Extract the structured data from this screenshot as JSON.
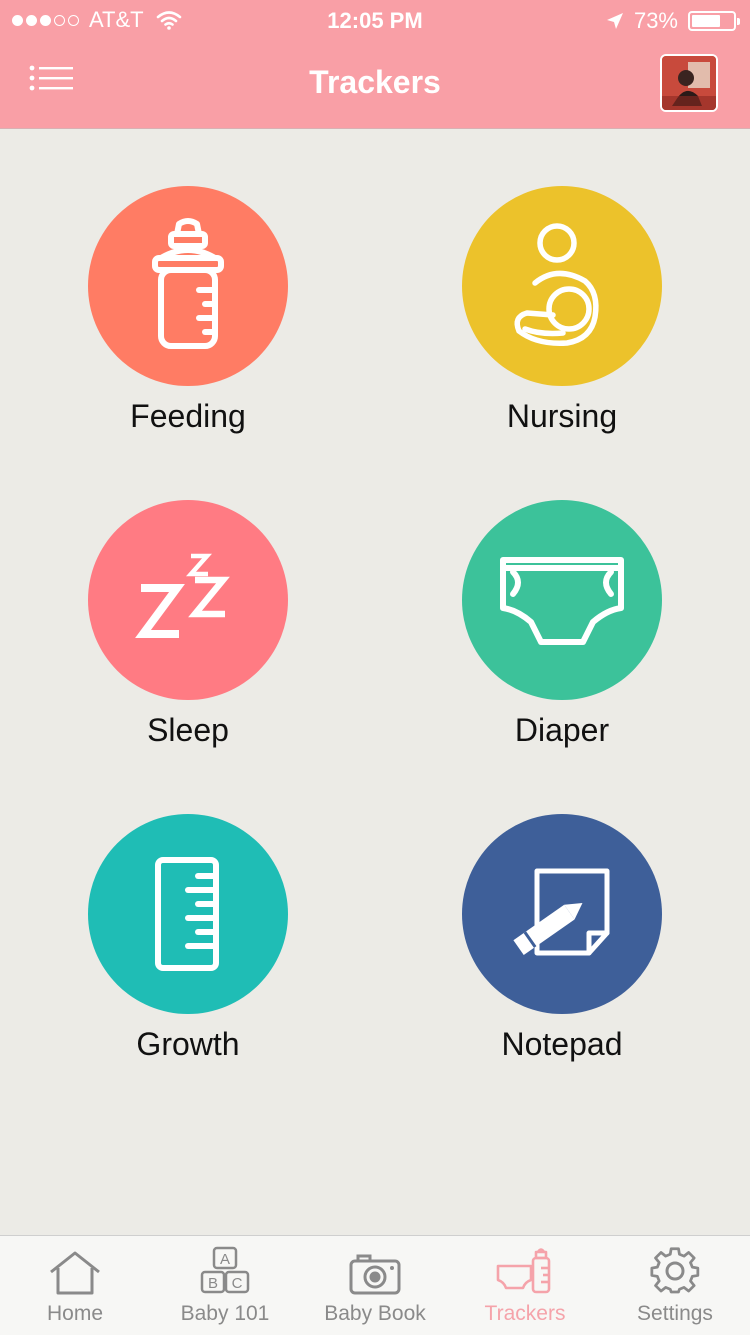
{
  "status_bar": {
    "carrier": "AT&T",
    "time": "12:05 PM",
    "battery": "73%",
    "battery_level": 0.73,
    "signal_bars_filled": 3,
    "signal_bars_total": 5
  },
  "nav": {
    "title": "Trackers",
    "menu_icon": "list-icon",
    "avatar": "profile-photo"
  },
  "trackers": [
    {
      "label": "Feeding",
      "color": "#ff7c64",
      "icon": "baby-bottle-icon"
    },
    {
      "label": "Nursing",
      "color": "#ecc22b",
      "icon": "nursing-mother-icon"
    },
    {
      "label": "Sleep",
      "color": "#ff7b83",
      "icon": "zzz-icon"
    },
    {
      "label": "Diaper",
      "color": "#3cc29a",
      "icon": "diaper-icon"
    },
    {
      "label": "Growth",
      "color": "#1fbdb5",
      "icon": "ruler-icon"
    },
    {
      "label": "Notepad",
      "color": "#3e5f99",
      "icon": "notepad-pencil-icon"
    }
  ],
  "tab_bar": {
    "tabs": [
      {
        "label": "Home",
        "icon": "home-icon"
      },
      {
        "label": "Baby 101",
        "icon": "abc-blocks-icon"
      },
      {
        "label": "Baby Book",
        "icon": "camera-icon"
      },
      {
        "label": "Trackers",
        "icon": "trackers-icon",
        "active": true
      },
      {
        "label": "Settings",
        "icon": "gear-icon"
      }
    ]
  },
  "colors": {
    "header": "#f99fa6",
    "background": "#ecebe6",
    "active_tab": "#f5a3aa",
    "inactive_tab": "#8a8a8a"
  }
}
